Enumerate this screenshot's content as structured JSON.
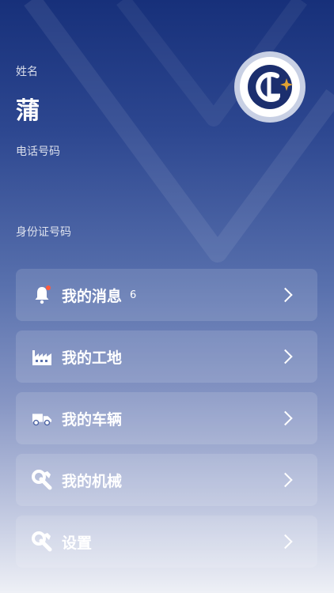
{
  "profile": {
    "name_label": "姓名",
    "name_value": "蒲",
    "phone_label": "电话号码",
    "phone_value": "",
    "id_label": "身份证号码",
    "id_value": ""
  },
  "menu": {
    "items": [
      {
        "label": "我的消息",
        "badge": "6",
        "icon": "bell-icon"
      },
      {
        "label": "我的工地",
        "icon": "factory-icon"
      },
      {
        "label": "我的车辆",
        "icon": "truck-icon"
      },
      {
        "label": "我的机械",
        "icon": "wrench-icon"
      },
      {
        "label": "设置",
        "icon": "wrench-icon"
      }
    ]
  },
  "colors": {
    "gradient_top": "#17307a",
    "gradient_bottom": "#eef0f6",
    "logo_navy": "#1c2f6e",
    "logo_gold": "#e0a233",
    "notification_dot": "#ff5a3c"
  }
}
